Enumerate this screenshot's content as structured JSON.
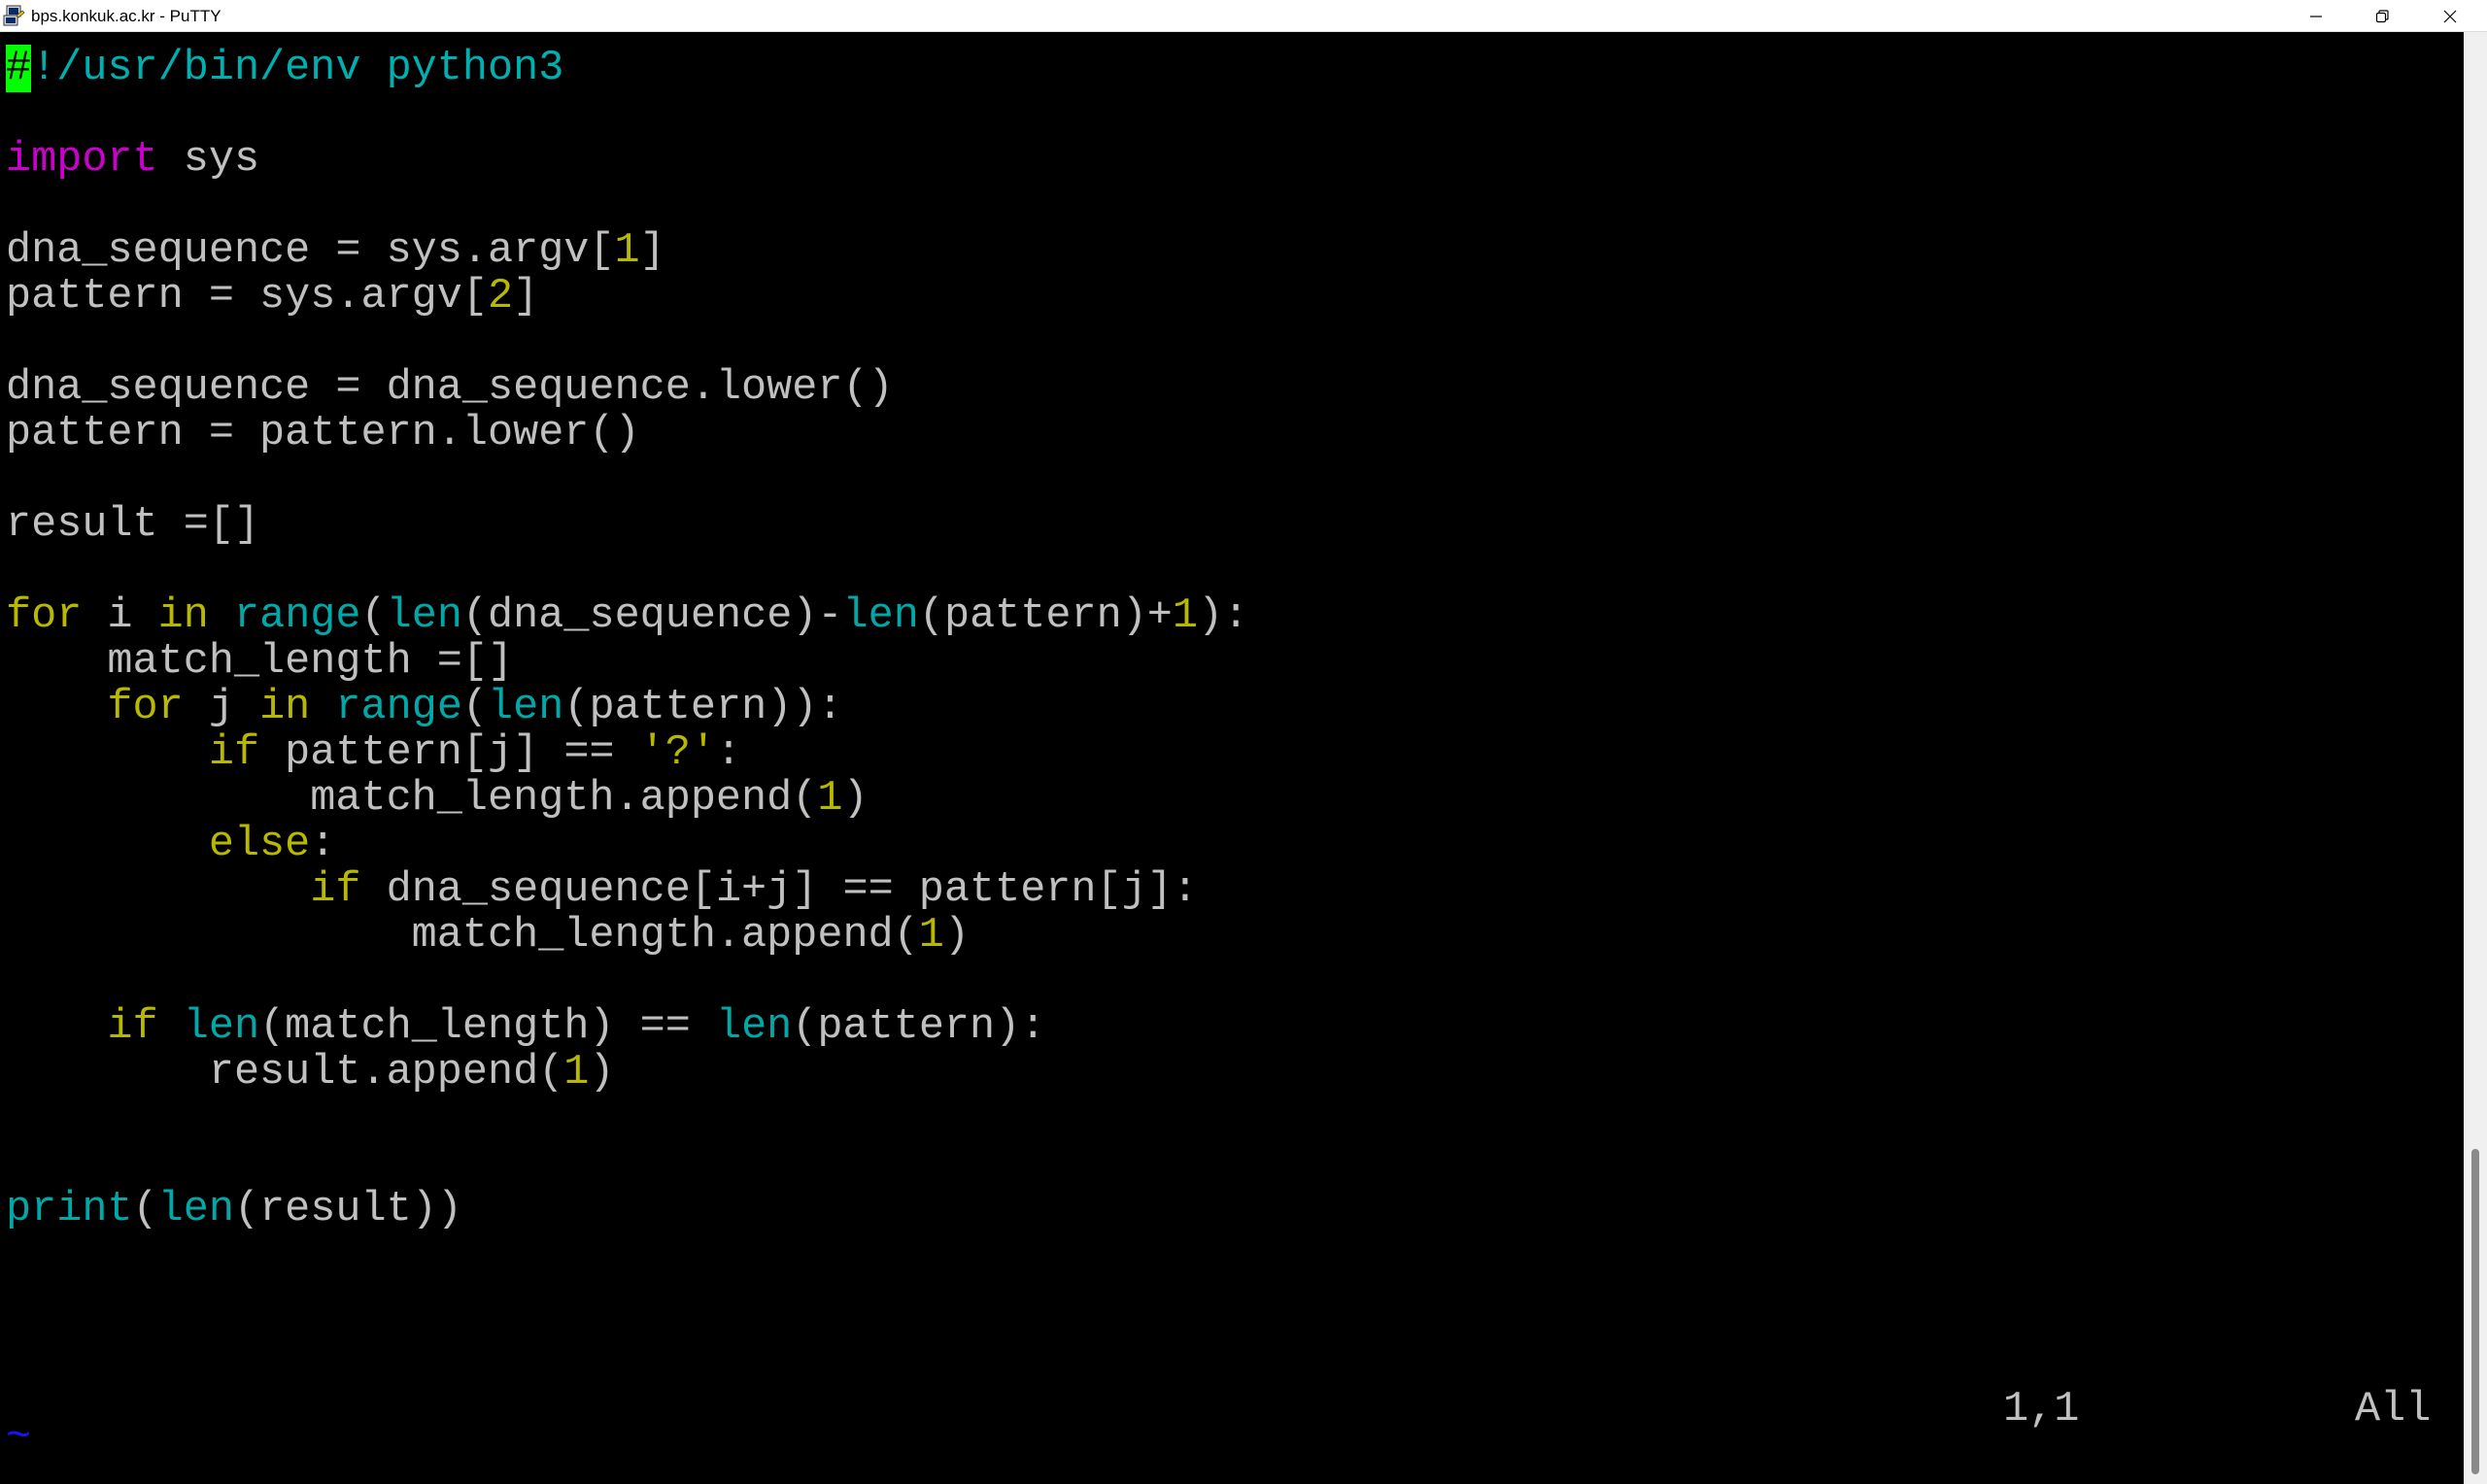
{
  "window": {
    "title": "bps.konkuk.ac.kr - PuTTY",
    "icon": "putty-icon",
    "controls": [
      "minimize-icon",
      "restore-icon",
      "close-icon"
    ]
  },
  "editor": {
    "cursor_char": "#",
    "lines": [
      [
        {
          "t": "#",
          "c": "cursor"
        },
        {
          "t": "!/usr/bin/env python3",
          "c": "sh"
        }
      ],
      [],
      [
        {
          "t": "import",
          "c": "imp"
        },
        {
          "t": " sys",
          "c": ""
        }
      ],
      [],
      [
        {
          "t": "dna_sequence = sys.argv[",
          "c": ""
        },
        {
          "t": "1",
          "c": "num"
        },
        {
          "t": "]",
          "c": ""
        }
      ],
      [
        {
          "t": "pattern = sys.argv[",
          "c": ""
        },
        {
          "t": "2",
          "c": "num"
        },
        {
          "t": "]",
          "c": ""
        }
      ],
      [],
      [
        {
          "t": "dna_sequence = dna_sequence.lower()",
          "c": ""
        }
      ],
      [
        {
          "t": "pattern = pattern.lower()",
          "c": ""
        }
      ],
      [],
      [
        {
          "t": "result =[]",
          "c": ""
        }
      ],
      [],
      [
        {
          "t": "for",
          "c": "kw"
        },
        {
          "t": " i ",
          "c": ""
        },
        {
          "t": "in",
          "c": "kw"
        },
        {
          "t": " ",
          "c": ""
        },
        {
          "t": "range",
          "c": "fn"
        },
        {
          "t": "(",
          "c": ""
        },
        {
          "t": "len",
          "c": "fn"
        },
        {
          "t": "(dna_sequence)-",
          "c": ""
        },
        {
          "t": "len",
          "c": "fn"
        },
        {
          "t": "(pattern)+",
          "c": ""
        },
        {
          "t": "1",
          "c": "num"
        },
        {
          "t": "):",
          "c": ""
        }
      ],
      [
        {
          "t": "    match_length =[]",
          "c": ""
        }
      ],
      [
        {
          "t": "    ",
          "c": ""
        },
        {
          "t": "for",
          "c": "kw"
        },
        {
          "t": " j ",
          "c": ""
        },
        {
          "t": "in",
          "c": "kw"
        },
        {
          "t": " ",
          "c": ""
        },
        {
          "t": "range",
          "c": "fn"
        },
        {
          "t": "(",
          "c": ""
        },
        {
          "t": "len",
          "c": "fn"
        },
        {
          "t": "(pattern)):",
          "c": ""
        }
      ],
      [
        {
          "t": "        ",
          "c": ""
        },
        {
          "t": "if",
          "c": "kw"
        },
        {
          "t": " pattern[j] == ",
          "c": ""
        },
        {
          "t": "'?'",
          "c": "str"
        },
        {
          "t": ":",
          "c": ""
        }
      ],
      [
        {
          "t": "            match_length.append(",
          "c": ""
        },
        {
          "t": "1",
          "c": "num"
        },
        {
          "t": ")",
          "c": ""
        }
      ],
      [
        {
          "t": "        ",
          "c": ""
        },
        {
          "t": "else",
          "c": "kw"
        },
        {
          "t": ":",
          "c": ""
        }
      ],
      [
        {
          "t": "            ",
          "c": ""
        },
        {
          "t": "if",
          "c": "kw"
        },
        {
          "t": " dna_sequence[i+j] == pattern[j]:",
          "c": ""
        }
      ],
      [
        {
          "t": "                match_length.append(",
          "c": ""
        },
        {
          "t": "1",
          "c": "num"
        },
        {
          "t": ")",
          "c": ""
        }
      ],
      [],
      [
        {
          "t": "    ",
          "c": ""
        },
        {
          "t": "if",
          "c": "kw"
        },
        {
          "t": " ",
          "c": ""
        },
        {
          "t": "len",
          "c": "fn"
        },
        {
          "t": "(match_length) == ",
          "c": ""
        },
        {
          "t": "len",
          "c": "fn"
        },
        {
          "t": "(pattern):",
          "c": ""
        }
      ],
      [
        {
          "t": "        result.append(",
          "c": ""
        },
        {
          "t": "1",
          "c": "num"
        },
        {
          "t": ")",
          "c": ""
        }
      ],
      [],
      [],
      [
        {
          "t": "print",
          "c": "fn"
        },
        {
          "t": "(",
          "c": ""
        },
        {
          "t": "len",
          "c": "fn"
        },
        {
          "t": "(result))",
          "c": ""
        }
      ],
      [],
      [],
      [],
      [],
      [
        {
          "t": "~",
          "c": "tilde"
        }
      ]
    ]
  },
  "statusline": {
    "position": "1,1",
    "scroll": "All"
  },
  "colors": {
    "background": "#000000",
    "foreground": "#c0c0c0",
    "keyword": "#b8b800",
    "import": "#cc00cc",
    "builtin": "#00a8a8",
    "cursor": "#00ff00",
    "tilde": "#1414ff"
  }
}
